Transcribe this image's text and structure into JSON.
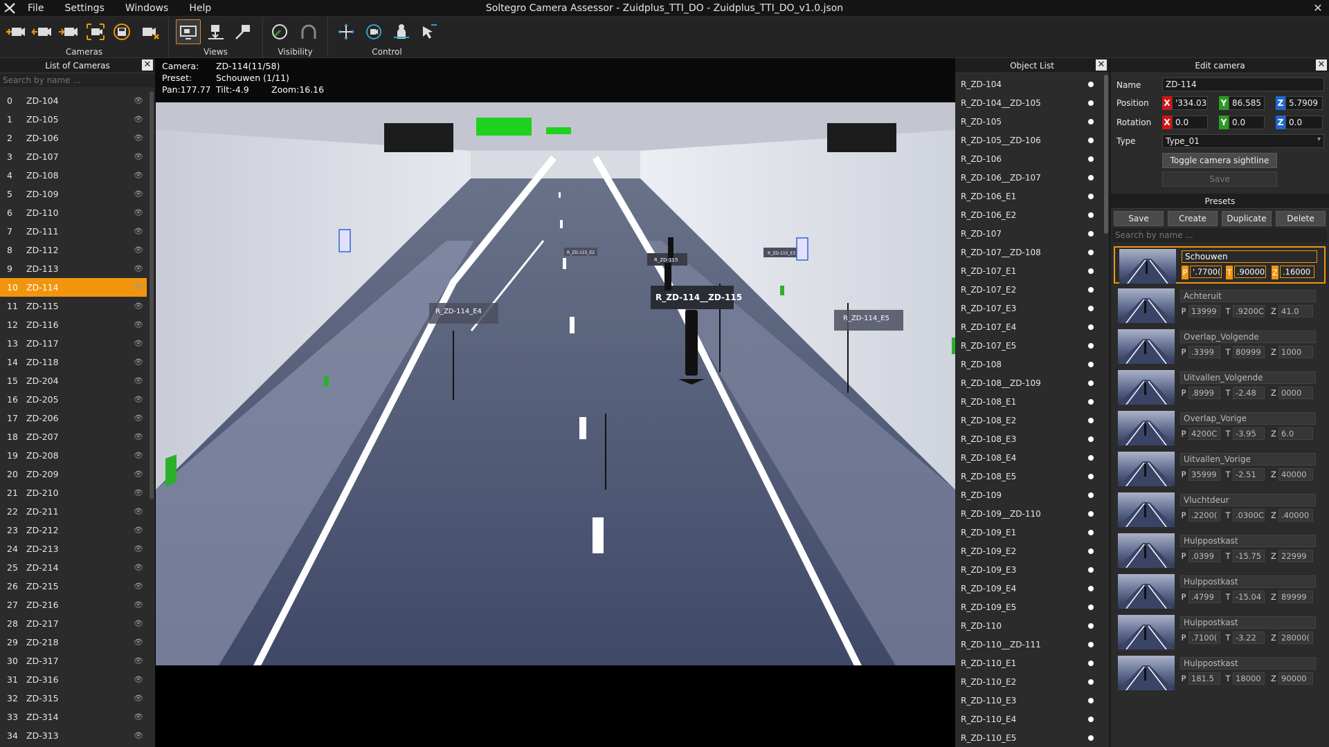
{
  "window": {
    "title": "Soltegro Camera Assessor - Zuidplus_TTI_DO - Zuidplus_TTI_DO_v1.0.json"
  },
  "menu": [
    "File",
    "Settings",
    "Windows",
    "Help"
  ],
  "toolbar": {
    "groups": [
      "Cameras",
      "Views",
      "Visibility",
      "Control"
    ]
  },
  "camera_list": {
    "title": "List of Cameras",
    "search_placeholder": "Search by name ...",
    "selected_index": 10,
    "cameras": [
      {
        "index": "0",
        "name": "ZD-104"
      },
      {
        "index": "1",
        "name": "ZD-105"
      },
      {
        "index": "2",
        "name": "ZD-106"
      },
      {
        "index": "3",
        "name": "ZD-107"
      },
      {
        "index": "4",
        "name": "ZD-108"
      },
      {
        "index": "5",
        "name": "ZD-109"
      },
      {
        "index": "6",
        "name": "ZD-110"
      },
      {
        "index": "7",
        "name": "ZD-111"
      },
      {
        "index": "8",
        "name": "ZD-112"
      },
      {
        "index": "9",
        "name": "ZD-113"
      },
      {
        "index": "10",
        "name": "ZD-114"
      },
      {
        "index": "11",
        "name": "ZD-115"
      },
      {
        "index": "12",
        "name": "ZD-116"
      },
      {
        "index": "13",
        "name": "ZD-117"
      },
      {
        "index": "14",
        "name": "ZD-118"
      },
      {
        "index": "15",
        "name": "ZD-204"
      },
      {
        "index": "16",
        "name": "ZD-205"
      },
      {
        "index": "17",
        "name": "ZD-206"
      },
      {
        "index": "18",
        "name": "ZD-207"
      },
      {
        "index": "19",
        "name": "ZD-208"
      },
      {
        "index": "20",
        "name": "ZD-209"
      },
      {
        "index": "21",
        "name": "ZD-210"
      },
      {
        "index": "22",
        "name": "ZD-211"
      },
      {
        "index": "23",
        "name": "ZD-212"
      },
      {
        "index": "24",
        "name": "ZD-213"
      },
      {
        "index": "25",
        "name": "ZD-214"
      },
      {
        "index": "26",
        "name": "ZD-215"
      },
      {
        "index": "27",
        "name": "ZD-216"
      },
      {
        "index": "28",
        "name": "ZD-217"
      },
      {
        "index": "29",
        "name": "ZD-218"
      },
      {
        "index": "30",
        "name": "ZD-317"
      },
      {
        "index": "31",
        "name": "ZD-316"
      },
      {
        "index": "32",
        "name": "ZD-315"
      },
      {
        "index": "33",
        "name": "ZD-314"
      },
      {
        "index": "34",
        "name": "ZD-313"
      }
    ]
  },
  "viewport": {
    "camera_label": "Camera:",
    "camera_value": "ZD-114(11/58)",
    "preset_label": "Preset:",
    "preset_value": "Schouwen (1/11)",
    "pan": "Pan:177.77",
    "tilt": "Tilt:-4.9",
    "zoom": "Zoom:16.16",
    "scene_labels": [
      "R_ZD-114__ZD-115",
      "R_ZD-114_E4",
      "R_ZD-114_E5",
      "R_ZD-115",
      "R_ZD-115_E2",
      "R_ZD-115_E3"
    ]
  },
  "object_list": {
    "title": "Object List",
    "items": [
      "R_ZD-104",
      "R_ZD-104__ZD-105",
      "R_ZD-105",
      "R_ZD-105__ZD-106",
      "R_ZD-106",
      "R_ZD-106__ZD-107",
      "R_ZD-106_E1",
      "R_ZD-106_E2",
      "R_ZD-107",
      "R_ZD-107__ZD-108",
      "R_ZD-107_E1",
      "R_ZD-107_E2",
      "R_ZD-107_E3",
      "R_ZD-107_E4",
      "R_ZD-107_E5",
      "R_ZD-108",
      "R_ZD-108__ZD-109",
      "R_ZD-108_E1",
      "R_ZD-108_E2",
      "R_ZD-108_E3",
      "R_ZD-108_E4",
      "R_ZD-108_E5",
      "R_ZD-109",
      "R_ZD-109__ZD-110",
      "R_ZD-109_E1",
      "R_ZD-109_E2",
      "R_ZD-109_E3",
      "R_ZD-109_E4",
      "R_ZD-109_E5",
      "R_ZD-110",
      "R_ZD-110__ZD-111",
      "R_ZD-110_E1",
      "R_ZD-110_E2",
      "R_ZD-110_E3",
      "R_ZD-110_E4",
      "R_ZD-110_E5"
    ]
  },
  "edit_camera": {
    "title": "Edit camera",
    "name_label": "Name",
    "name_value": "ZD-114",
    "position_label": "Position",
    "position": {
      "x": "'334.03",
      "y": "86.585",
      "z": "5.7909"
    },
    "rotation_label": "Rotation",
    "rotation": {
      "x": "0.0",
      "y": "0.0",
      "z": "0.0"
    },
    "type_label": "Type",
    "type_value": "Type_01",
    "toggle_button": "Toggle camera sightline",
    "save_button": "Save",
    "axis_x": "X",
    "axis_y": "Y",
    "axis_z": "Z"
  },
  "presets": {
    "title": "Presets",
    "buttons": [
      "Save",
      "Create",
      "Duplicate",
      "Delete"
    ],
    "search_placeholder": "Search by name ...",
    "label_p": "P",
    "label_t": "T",
    "label_z": "Z",
    "items": [
      {
        "name": "Schouwen",
        "p": "'.7700(",
        "t": ".90000",
        "z": ".16000",
        "selected": true
      },
      {
        "name": "Achteruit",
        "p": "13999",
        "t": ".9200C",
        "z": "41.0"
      },
      {
        "name": "Overlap_Volgende",
        "p": ".3399",
        "t": "80999",
        "z": "1000"
      },
      {
        "name": "Uitvallen_Volgende",
        "p": ".8999",
        "t": "-2.48",
        "z": "0000"
      },
      {
        "name": "Overlap_Vorige",
        "p": "4200C",
        "t": "-3.95",
        "z": "6.0"
      },
      {
        "name": "Uitvallen_Vorige",
        "p": "35999",
        "t": "-2.51",
        "z": "40000"
      },
      {
        "name": "Vluchtdeur",
        "p": ".2200(",
        "t": ".0300C",
        "z": ".40000"
      },
      {
        "name": "Hulppostkast",
        "p": ".0399",
        "t": "-15.75",
        "z": "22999"
      },
      {
        "name": "Hulppostkast",
        "p": ".4799",
        "t": "-15.04",
        "z": "89999"
      },
      {
        "name": "Hulppostkast",
        "p": ".7100(",
        "t": "-3.22",
        "z": "28000("
      },
      {
        "name": "Hulppostkast",
        "p": "181.5",
        "t": "18000",
        "z": "90000"
      }
    ]
  }
}
